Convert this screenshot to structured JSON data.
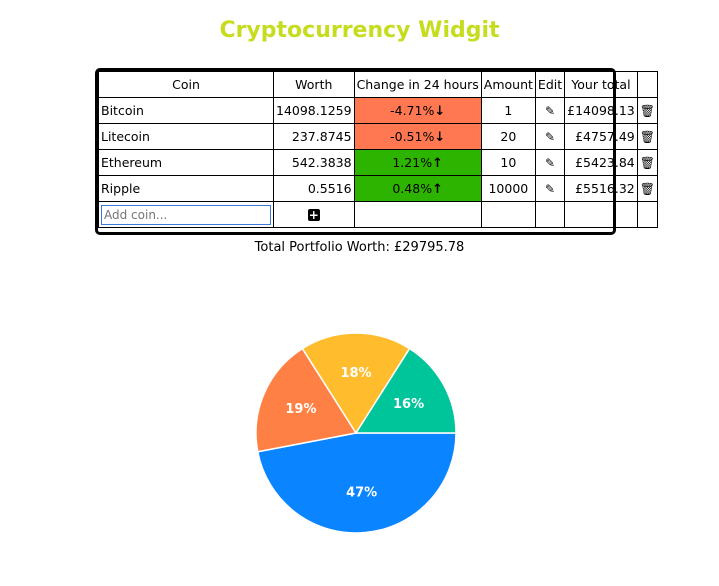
{
  "title": "Cryptocurrency Widgit",
  "table": {
    "headers": {
      "coin": "Coin",
      "worth": "Worth",
      "change": "Change in 24 hours",
      "amount": "Amount",
      "edit": "Edit",
      "total": "Your total"
    },
    "rows": [
      {
        "coin": "Bitcoin",
        "worth": "14098.1259",
        "change": "-4.71%",
        "direction": "down",
        "amount": "1",
        "total": "£14098.13"
      },
      {
        "coin": "Litecoin",
        "worth": "237.8745",
        "change": "-0.51%",
        "direction": "down",
        "amount": "20",
        "total": "£4757.49"
      },
      {
        "coin": "Ethereum",
        "worth": "542.3838",
        "change": "1.21%",
        "direction": "up",
        "amount": "10",
        "total": "£5423.84"
      },
      {
        "coin": "Ripple",
        "worth": "0.5516",
        "change": "0.48%",
        "direction": "up",
        "amount": "10000",
        "total": "£5516.32"
      }
    ],
    "add_placeholder": "Add coin..."
  },
  "portfolio_label": "Total Portfolio Worth: £29795.78",
  "colors": {
    "title": "#c6dc1e",
    "down": "#ff7852",
    "up": "#2db400"
  },
  "icons": {
    "edit": "pencil-icon",
    "delete": "trash-icon",
    "add": "plus-icon",
    "down": "arrow-down-icon",
    "up": "arrow-up-icon"
  },
  "chart_data": {
    "type": "pie",
    "slices": [
      {
        "label": "47%",
        "value": 47,
        "color": "#0a84ff"
      },
      {
        "label": "19%",
        "value": 19,
        "color": "#ff8044"
      },
      {
        "label": "18%",
        "value": 18,
        "color": "#ffbd2e"
      },
      {
        "label": "16%",
        "value": 16,
        "color": "#00c59a"
      }
    ],
    "start": "3 o'clock",
    "direction": "clockwise"
  }
}
